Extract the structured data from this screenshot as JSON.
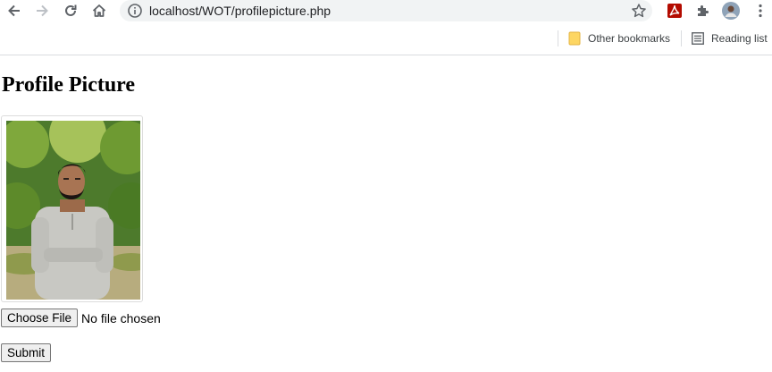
{
  "browser": {
    "url": "localhost/WOT/profilepicture.php",
    "nav_icons": [
      "back-arrow-icon",
      "forward-arrow-icon",
      "reload-icon",
      "home-icon"
    ],
    "omnibox_icons": [
      "info-icon",
      "star-icon"
    ],
    "extension_icons": [
      "pdf-extension-icon",
      "puzzle-icon",
      "profile-avatar",
      "kebab-menu-icon"
    ]
  },
  "bookmarks_bar": {
    "other_bookmarks": "Other bookmarks",
    "reading_list": "Reading list"
  },
  "page": {
    "title": "Profile Picture",
    "file_input": {
      "button_label": "Choose File",
      "status": "No file chosen"
    },
    "submit_label": "Submit"
  },
  "colors": {
    "omnibox_bg": "#f1f3f4",
    "folder_yellow": "#fdd663",
    "pdf_red": "#b30b00"
  }
}
